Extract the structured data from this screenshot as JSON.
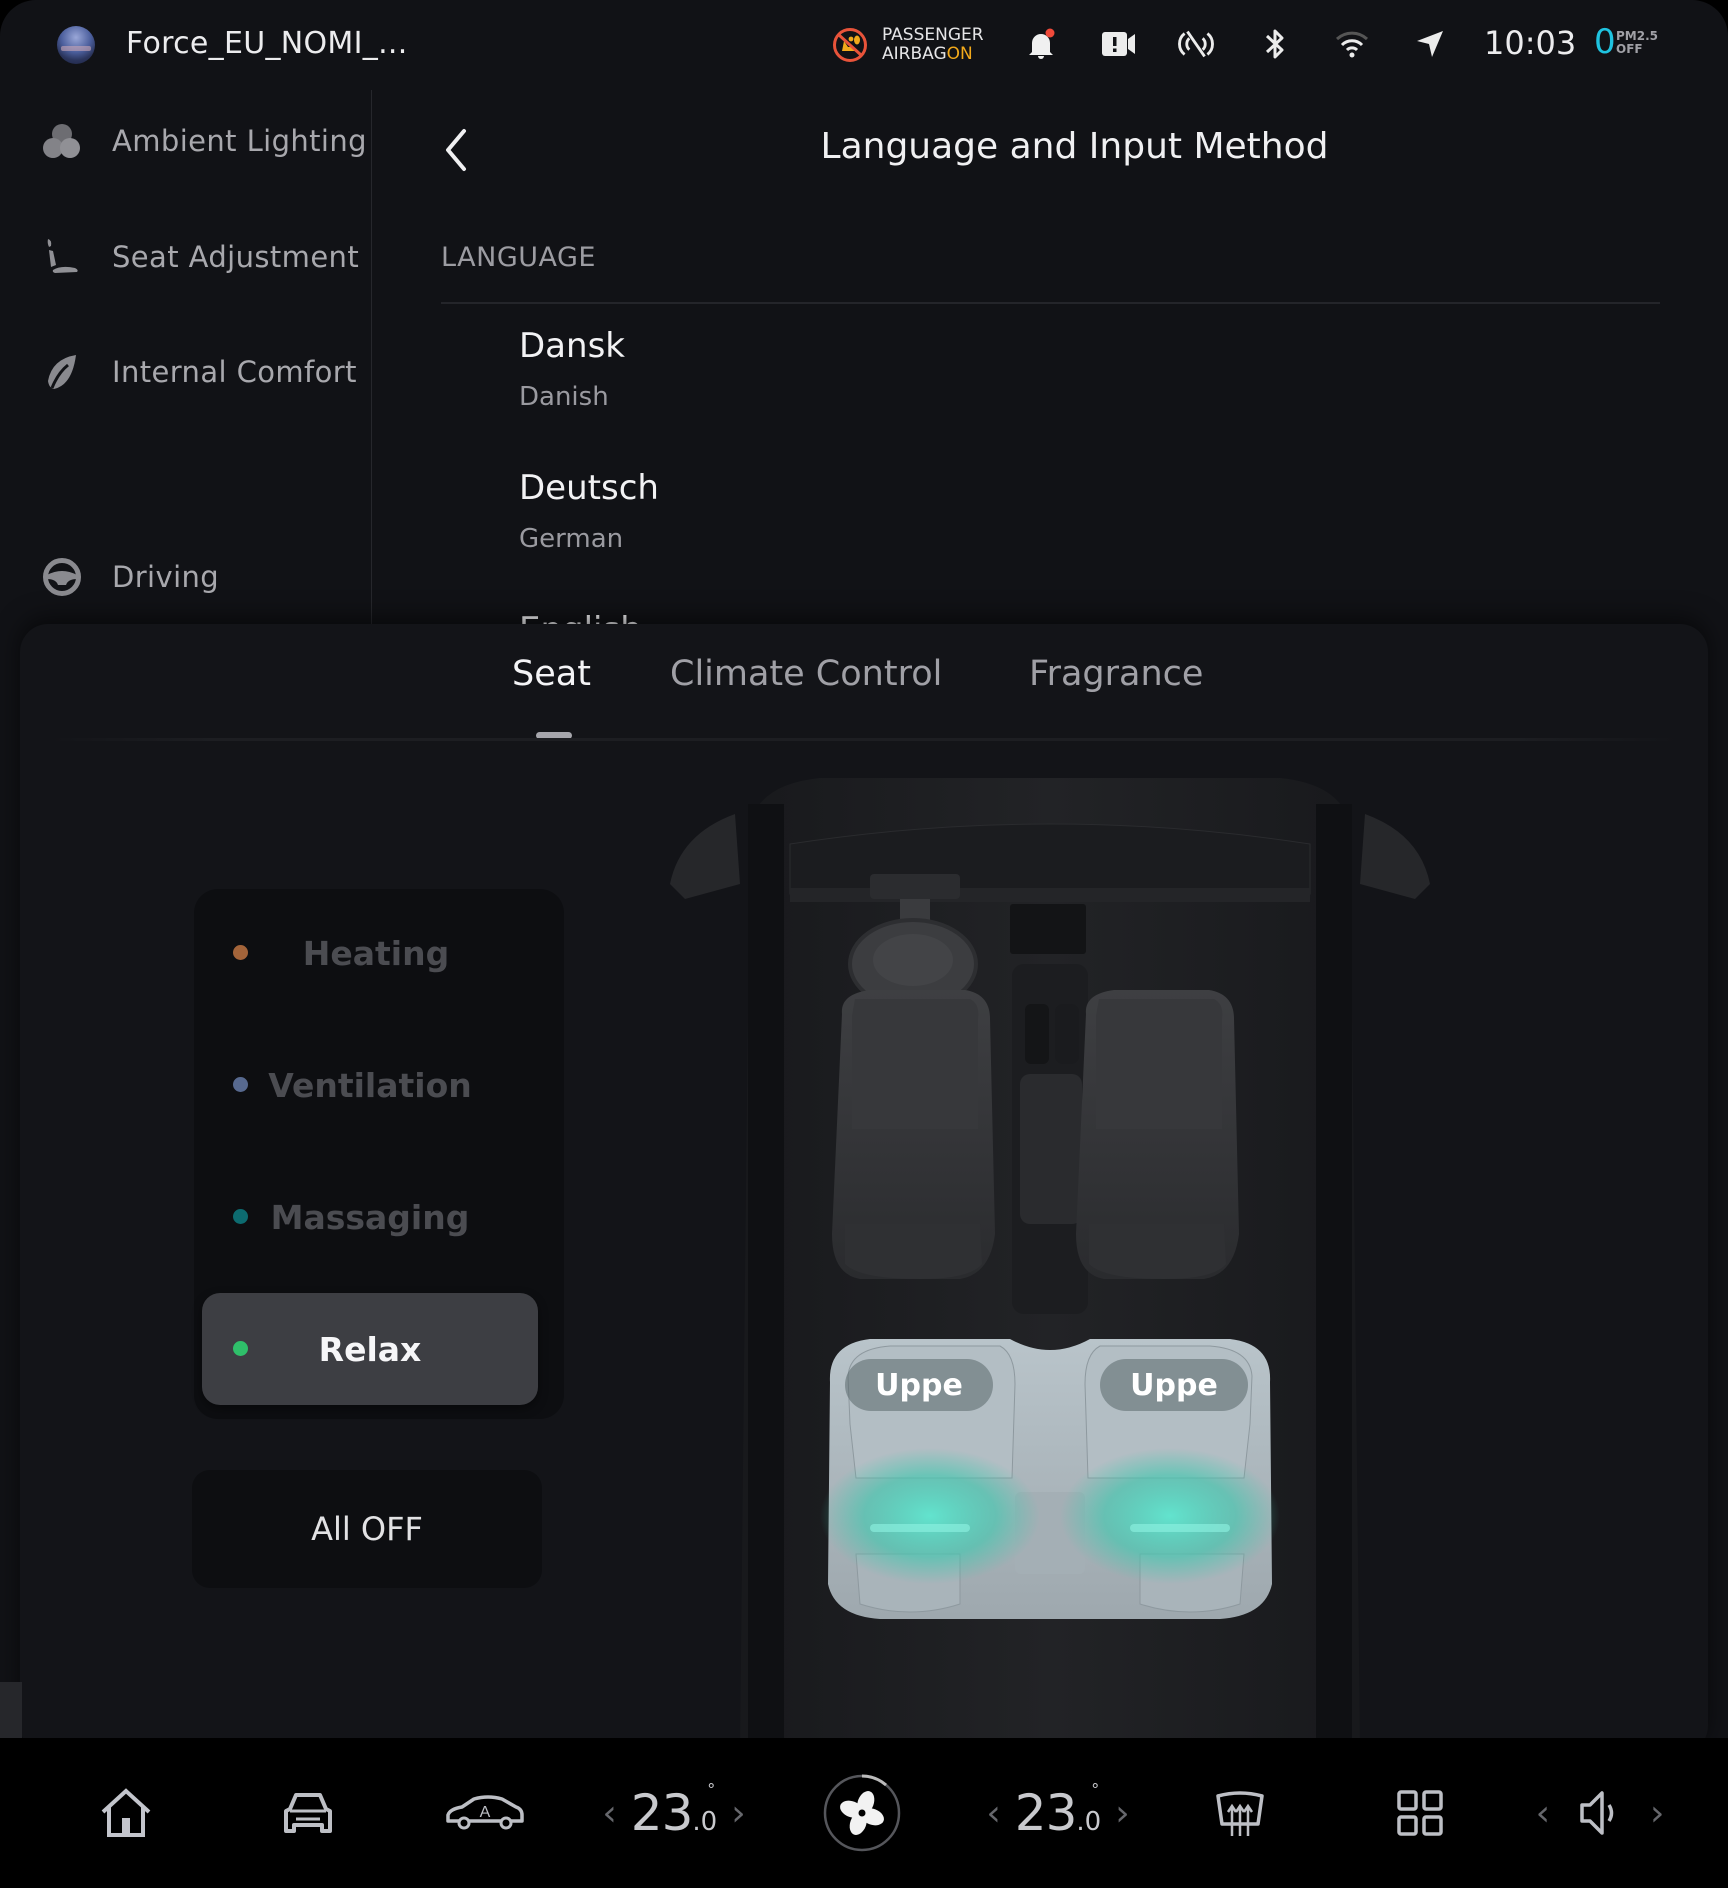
{
  "status_bar": {
    "user_name": "Force_EU_NOMI_...",
    "airbag": {
      "line1": "PASSENGER",
      "line2": "AIRBAG",
      "state": "ON"
    },
    "icons": [
      "notification-bell-icon",
      "dashcam-alert-icon",
      "signal-off-icon",
      "bluetooth-icon",
      "wifi-icon",
      "location-arrow-icon"
    ],
    "time": "10:03",
    "pm25": {
      "value": "0",
      "label": "PM2.5",
      "state": "OFF"
    },
    "colors": {
      "airbag_on": "#f2a91b",
      "pm_value": "#1fc3e0",
      "notification_dot": "#f04a3a"
    }
  },
  "sidebar": {
    "items": [
      {
        "label": "Ambient Lighting",
        "icon": "ambient-lighting-icon"
      },
      {
        "label": "Seat Adjustment",
        "icon": "seat-icon"
      },
      {
        "label": "Internal Comfort",
        "icon": "leaf-icon"
      },
      {
        "label": "Driving",
        "icon": "steering-wheel-icon"
      }
    ]
  },
  "content": {
    "title": "Language and Input Method",
    "section": "LANGUAGE",
    "languages": [
      {
        "name": "Dansk",
        "english": "Danish"
      },
      {
        "name": "Deutsch",
        "english": "German"
      },
      {
        "name": "English",
        "english": ""
      }
    ]
  },
  "overlay": {
    "tabs": [
      {
        "label": "Seat",
        "active": true
      },
      {
        "label": "Climate Control",
        "active": false
      },
      {
        "label": "Fragrance",
        "active": false
      }
    ],
    "features": [
      {
        "label": "Heating",
        "dot_color": "#a3643a",
        "active": false
      },
      {
        "label": "Ventilation",
        "dot_color": "#57698f",
        "active": false
      },
      {
        "label": "Massaging",
        "dot_color": "#0d6b70",
        "active": false
      },
      {
        "label": "Relax",
        "dot_color": "#2fbf6a",
        "active": true
      }
    ],
    "all_off_label": "All OFF",
    "seat_labels": [
      "Uppe",
      "Uppe"
    ],
    "glow_color": "#4fd8c0"
  },
  "dock": {
    "left_temp": {
      "whole": "23",
      "decimal": ".0",
      "unit": "°"
    },
    "right_temp": {
      "whole": "23",
      "decimal": ".0",
      "unit": "°"
    },
    "icons": [
      "home-icon",
      "car-front-icon",
      "auto-car-icon",
      "fan-icon",
      "rear-defrost-icon",
      "apps-grid-icon",
      "volume-icon"
    ]
  }
}
